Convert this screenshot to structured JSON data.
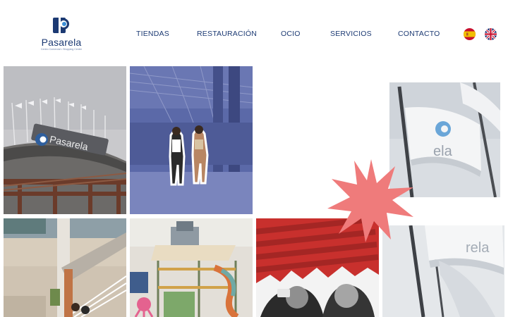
{
  "brand": {
    "name": "Pasarela",
    "tagline": "Centro Comercial • Shopping Center",
    "color": "#1c3a73"
  },
  "nav": {
    "items": [
      "TIENDAS",
      "RESTAURACIÓN",
      "OCIO",
      "SERVICIOS",
      "CONTACTO"
    ]
  },
  "languages": [
    "es-flag-icon",
    "uk-flag-icon"
  ],
  "gallery": {
    "tiles": [
      "mall-facade-photo",
      "shoppers-walking-photo",
      "flag-with-logo-photo",
      "interior-stairs-photo",
      "playground-photo",
      "friends-selfie-photo",
      "flags-bottom-photo"
    ],
    "photo_signs": {
      "facade_sign": "Pasarela",
      "flag_text": "ela",
      "flag_text_bottom": "rela"
    },
    "accent_colors": {
      "burst": "#ef7b7b",
      "red_overlay": "#c8302d",
      "blue_overlay": "#5b69a8"
    }
  }
}
